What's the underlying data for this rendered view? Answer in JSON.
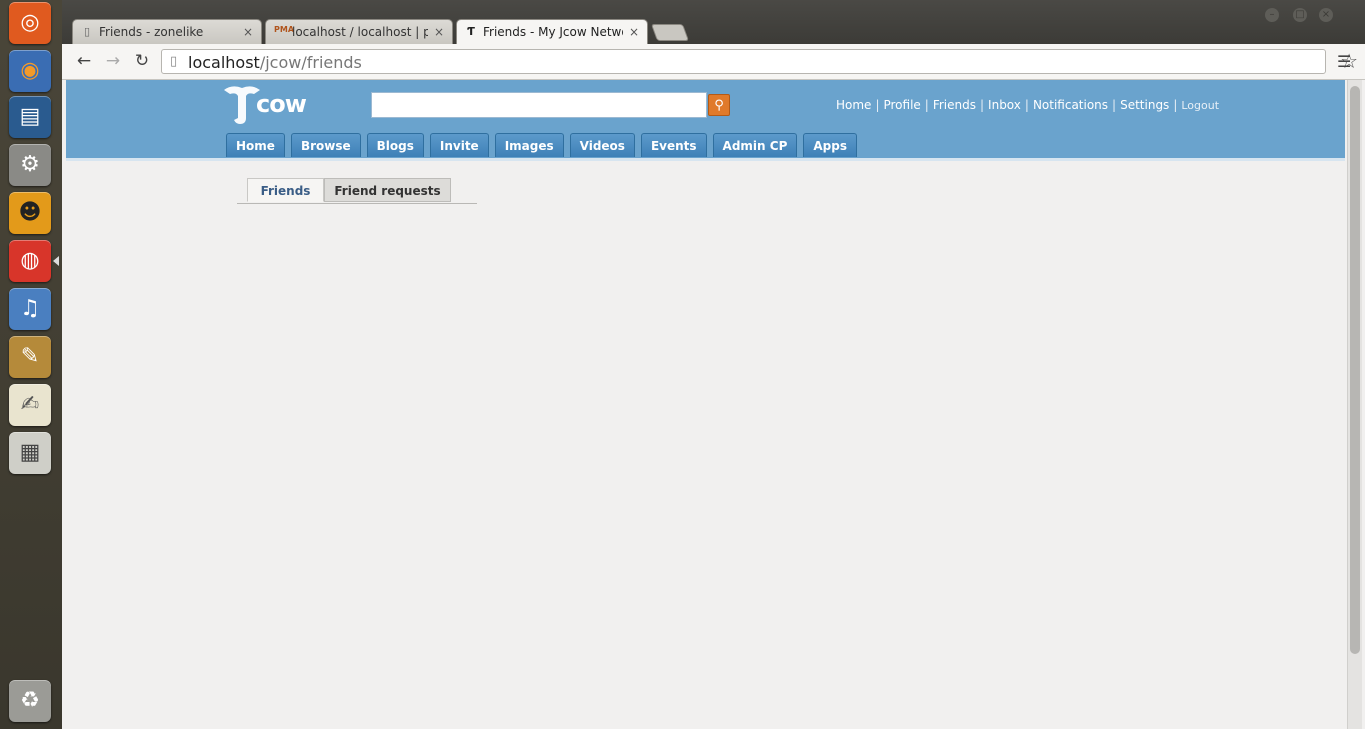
{
  "launcher": {
    "icons": [
      {
        "name": "ubuntu-dash-icon",
        "color": "#e05a1f",
        "glyph": "◎"
      },
      {
        "name": "firefox-icon",
        "color": "#e0782a",
        "glyph": "◉"
      },
      {
        "name": "terminal-editor-icon",
        "color": "#2a5b8f",
        "glyph": "▤"
      },
      {
        "name": "system-settings-icon",
        "color": "#8a8a86",
        "glyph": "⚙"
      },
      {
        "name": "people-icon",
        "color": "#e39a1a",
        "glyph": "☻"
      },
      {
        "name": "chrome-icon",
        "color": "#d8352a",
        "glyph": "◍"
      },
      {
        "name": "music-player-icon",
        "color": "#4a7fc0",
        "glyph": "♫"
      },
      {
        "name": "paint-icon",
        "color": "#b58a3a",
        "glyph": "✎"
      },
      {
        "name": "text-editor-icon",
        "color": "#e9e4cf",
        "glyph": "✍"
      },
      {
        "name": "calculator-icon",
        "color": "#cfcfc8",
        "glyph": "▦"
      },
      {
        "name": "trash-icon",
        "color": "#9b9b96",
        "glyph": "♻"
      }
    ]
  },
  "browser": {
    "tabs": [
      {
        "label": "Friends - zonelike",
        "icon": "page-icon"
      },
      {
        "label": "localhost / localhost | ph",
        "icon": "pma-icon"
      },
      {
        "label": "Friends - My Jcow Netwo",
        "icon": "jcow-icon"
      }
    ],
    "close_glyph": "×",
    "url_host": "localhost",
    "url_path": "/jcow/friends"
  },
  "site": {
    "logo_text": "cow",
    "search_placeholder": "",
    "top_links": [
      "Home",
      "Profile",
      "Friends",
      "Inbox",
      "Notifications",
      "Settings"
    ],
    "logout": "Logout",
    "nav": [
      "Home",
      "Browse",
      "Blogs",
      "Invite",
      "Images",
      "Videos",
      "Events",
      "Admin CP",
      "Apps"
    ],
    "accent": "#6aa3cd",
    "nav_color": "#3e80b7"
  },
  "page_tabs": {
    "friends": "Friends",
    "requests": "Friend requests"
  }
}
